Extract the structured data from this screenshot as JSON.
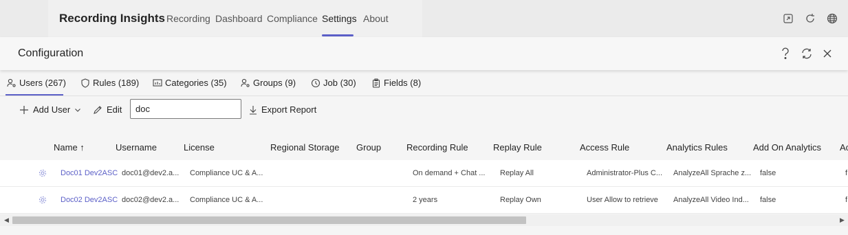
{
  "app": {
    "title": "Recording Insights",
    "nav": [
      "Recording",
      "Dashboard",
      "Compliance",
      "Settings",
      "About"
    ],
    "active_nav": "Settings"
  },
  "top_icons": [
    "popout-icon",
    "refresh-icon",
    "globe-icon"
  ],
  "config": {
    "title": "Configuration",
    "icons": [
      "help-icon",
      "sync-icon",
      "close-icon"
    ]
  },
  "tabs": [
    {
      "label": "Users (267)",
      "icon": "users-icon"
    },
    {
      "label": "Rules (189)",
      "icon": "shield-icon"
    },
    {
      "label": "Categories (35)",
      "icon": "categories-icon"
    },
    {
      "label": "Groups (9)",
      "icon": "groups-icon"
    },
    {
      "label": "Job (30)",
      "icon": "job-icon"
    },
    {
      "label": "Fields (8)",
      "icon": "clipboard-icon"
    }
  ],
  "toolbar": {
    "add_user": "Add User",
    "edit": "Edit",
    "search_value": "doc",
    "export": "Export Report"
  },
  "table": {
    "headers": [
      "Name ↑",
      "Username",
      "License",
      "Regional Storage",
      "Group",
      "Recording Rule",
      "Replay Rule",
      "Access Rule",
      "Analytics Rules",
      "Add On Analytics",
      "Ac"
    ],
    "rows": [
      [
        "Doc01 Dev2ASC",
        "doc01@dev2.a...",
        "Compliance UC & A...",
        "",
        "",
        "On demand + Chat ...",
        "Replay All",
        "Administrator-Plus C...",
        "AnalyzeAll Sprache z...",
        "false",
        "f"
      ],
      [
        "Doc02 Dev2ASC",
        "doc02@dev2.a...",
        "Compliance UC & A...",
        "",
        "",
        "2 years",
        "Replay Own",
        "User Allow to retrieve",
        "AnalyzeAll Video Ind...",
        "false",
        "f"
      ]
    ]
  },
  "accent_color": "#5b5fc7"
}
